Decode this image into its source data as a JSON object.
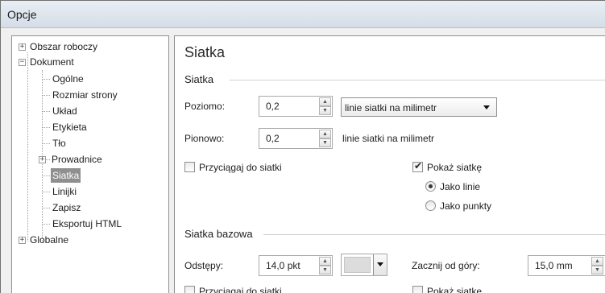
{
  "window": {
    "title": "Opcje"
  },
  "tree": {
    "items": [
      {
        "label": "Obszar roboczy",
        "expander": "+"
      },
      {
        "label": "Dokument",
        "expander": "−"
      },
      {
        "label": "Ogólne"
      },
      {
        "label": "Rozmiar strony"
      },
      {
        "label": "Układ"
      },
      {
        "label": "Etykieta"
      },
      {
        "label": "Tło"
      },
      {
        "label": "Prowadnice",
        "expander": "+"
      },
      {
        "label": "Siatka",
        "selected": true
      },
      {
        "label": "Linijki"
      },
      {
        "label": "Zapisz"
      },
      {
        "label": "Eksportuj HTML"
      },
      {
        "label": "Globalne",
        "expander": "+"
      }
    ]
  },
  "main": {
    "title": "Siatka",
    "grid": {
      "title": "Siatka",
      "horizontal_label": "Poziomo:",
      "horizontal_value": "0,2",
      "units_select": "linie siatki na milimetr",
      "vertical_label": "Pionowo:",
      "vertical_value": "0,2",
      "vertical_units": "linie siatki na milimetr",
      "snap_label": "Przyciągaj do siatki",
      "snap_checked": false,
      "show_label": "Pokaż siatkę",
      "show_checked": true,
      "radio_lines": "Jako linie",
      "radio_points": "Jako punkty",
      "selected_mode": "lines"
    },
    "baseline": {
      "title": "Siatka bazowa",
      "spacing_label": "Odstępy:",
      "spacing_value": "14,0 pkt",
      "start_label": "Zacznij od góry:",
      "start_value": "15,0 mm",
      "snap_label": "Przyciągaj do siatki",
      "show_label": "Pokaż siatkę"
    }
  },
  "colors": {
    "selection": "#8f8f8f",
    "swatch": "#dcdcdc"
  }
}
